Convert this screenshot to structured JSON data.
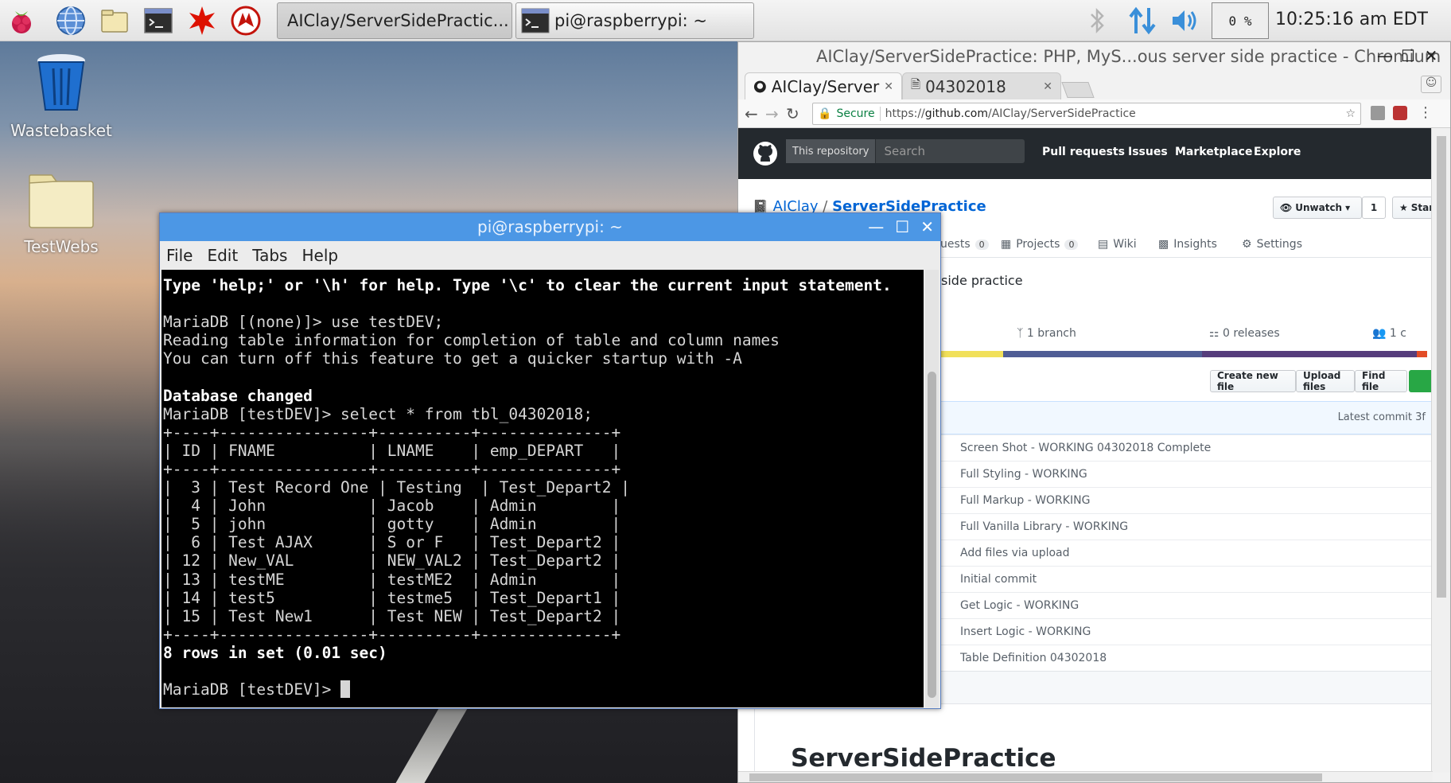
{
  "taskbar": {
    "apps": [
      {
        "name": "raspberry-menu-icon"
      },
      {
        "name": "web-browser-icon"
      },
      {
        "name": "file-manager-icon"
      },
      {
        "name": "terminal-icon"
      },
      {
        "name": "wolfram-icon"
      },
      {
        "name": "mathematica-icon"
      }
    ],
    "tasks": [
      {
        "label": "AIClay/ServerSidePractic...",
        "active": true
      },
      {
        "label": "pi@raspberrypi: ~",
        "active": false
      }
    ],
    "cpu": "0 %",
    "clock": "10:25:16 am EDT"
  },
  "desktop": {
    "icons": [
      {
        "label": "Wastebasket"
      },
      {
        "label": "TestWebs"
      }
    ]
  },
  "chromium": {
    "title": "AIClay/ServerSidePractice: PHP, MyS...ous server side practice - Chromium",
    "tabs": [
      {
        "label": "AIClay/Server"
      },
      {
        "label": "04302018"
      }
    ],
    "secure_label": "Secure",
    "url_scheme": "https://",
    "url_host": "github.com",
    "url_path": "/AIClay/ServerSidePractice",
    "github": {
      "search_scope": "This repository",
      "search_placeholder": "Search",
      "nav": [
        "Pull requests",
        "Issues",
        "Marketplace",
        "Explore"
      ],
      "owner": "AIClay",
      "repo": "ServerSidePractice",
      "unwatch_label": "Unwatch",
      "watch_count": "1",
      "star_label": "Star",
      "repo_tabs": [
        {
          "label": "ull requests",
          "count": "0"
        },
        {
          "label": "Projects",
          "count": "0"
        },
        {
          "label": "Wiki"
        },
        {
          "label": "Insights"
        },
        {
          "label": "Settings"
        }
      ],
      "description_fragment": "side practice",
      "branches": "1 branch",
      "releases": "0 releases",
      "contributors": "1 c",
      "create_file": "Create new file",
      "upload_files": "Upload files",
      "find_file": "Find file",
      "latest_commit": "Latest commit 3f",
      "commits": [
        "Screen Shot - WORKING 04302018 Complete",
        "Full Styling - WORKING",
        "Full Markup - WORKING",
        "Full Vanilla Library - WORKING",
        "Add files via upload",
        "Initial commit",
        "Get Logic - WORKING",
        "Insert Logic - WORKING",
        "Table Definition 04302018"
      ],
      "readme_heading": "ServerSidePractice"
    }
  },
  "terminal": {
    "title": "pi@raspberrypi: ~",
    "menu": [
      "File",
      "Edit",
      "Tabs",
      "Help"
    ],
    "lines": [
      {
        "text": "Type 'help;' or '\\h' for help. Type '\\c' to clear the current input statement.",
        "bold": true
      },
      {
        "text": "",
        "bold": false
      },
      {
        "text": "MariaDB [(none)]> use testDEV;",
        "bold": false
      },
      {
        "text": "Reading table information for completion of table and column names",
        "bold": false
      },
      {
        "text": "You can turn off this feature to get a quicker startup with -A",
        "bold": false
      },
      {
        "text": "",
        "bold": false
      },
      {
        "text": "Database changed",
        "bold": true
      },
      {
        "text": "MariaDB [testDEV]> select * from tbl_04302018;",
        "bold": false
      },
      {
        "text": "+----+----------------+----------+--------------+",
        "bold": false
      },
      {
        "text": "| ID | FNAME          | LNAME    | emp_DEPART   |",
        "bold": false
      },
      {
        "text": "+----+----------------+----------+--------------+",
        "bold": false
      },
      {
        "text": "|  3 | Test Record One | Testing  | Test_Depart2 |",
        "bold": false
      },
      {
        "text": "|  4 | John           | Jacob    | Admin        |",
        "bold": false
      },
      {
        "text": "|  5 | john           | gotty    | Admin        |",
        "bold": false
      },
      {
        "text": "|  6 | Test AJAX      | S or F   | Test_Depart2 |",
        "bold": false
      },
      {
        "text": "| 12 | New_VAL        | NEW_VAL2 | Test_Depart2 |",
        "bold": false
      },
      {
        "text": "| 13 | testME         | testME2  | Admin        |",
        "bold": false
      },
      {
        "text": "| 14 | test5          | testme5  | Test_Depart1 |",
        "bold": false
      },
      {
        "text": "| 15 | Test New1      | Test NEW | Test_Depart2 |",
        "bold": false
      },
      {
        "text": "+----+----------------+----------+--------------+",
        "bold": false
      },
      {
        "text": "8 rows in set (0.01 sec)",
        "bold": true
      },
      {
        "text": "",
        "bold": false
      }
    ],
    "prompt": "MariaDB [testDEV]> "
  },
  "colors": {
    "terminal_titlebar": "#4c97e5",
    "github_header": "#24292e",
    "link": "#0366d6"
  }
}
